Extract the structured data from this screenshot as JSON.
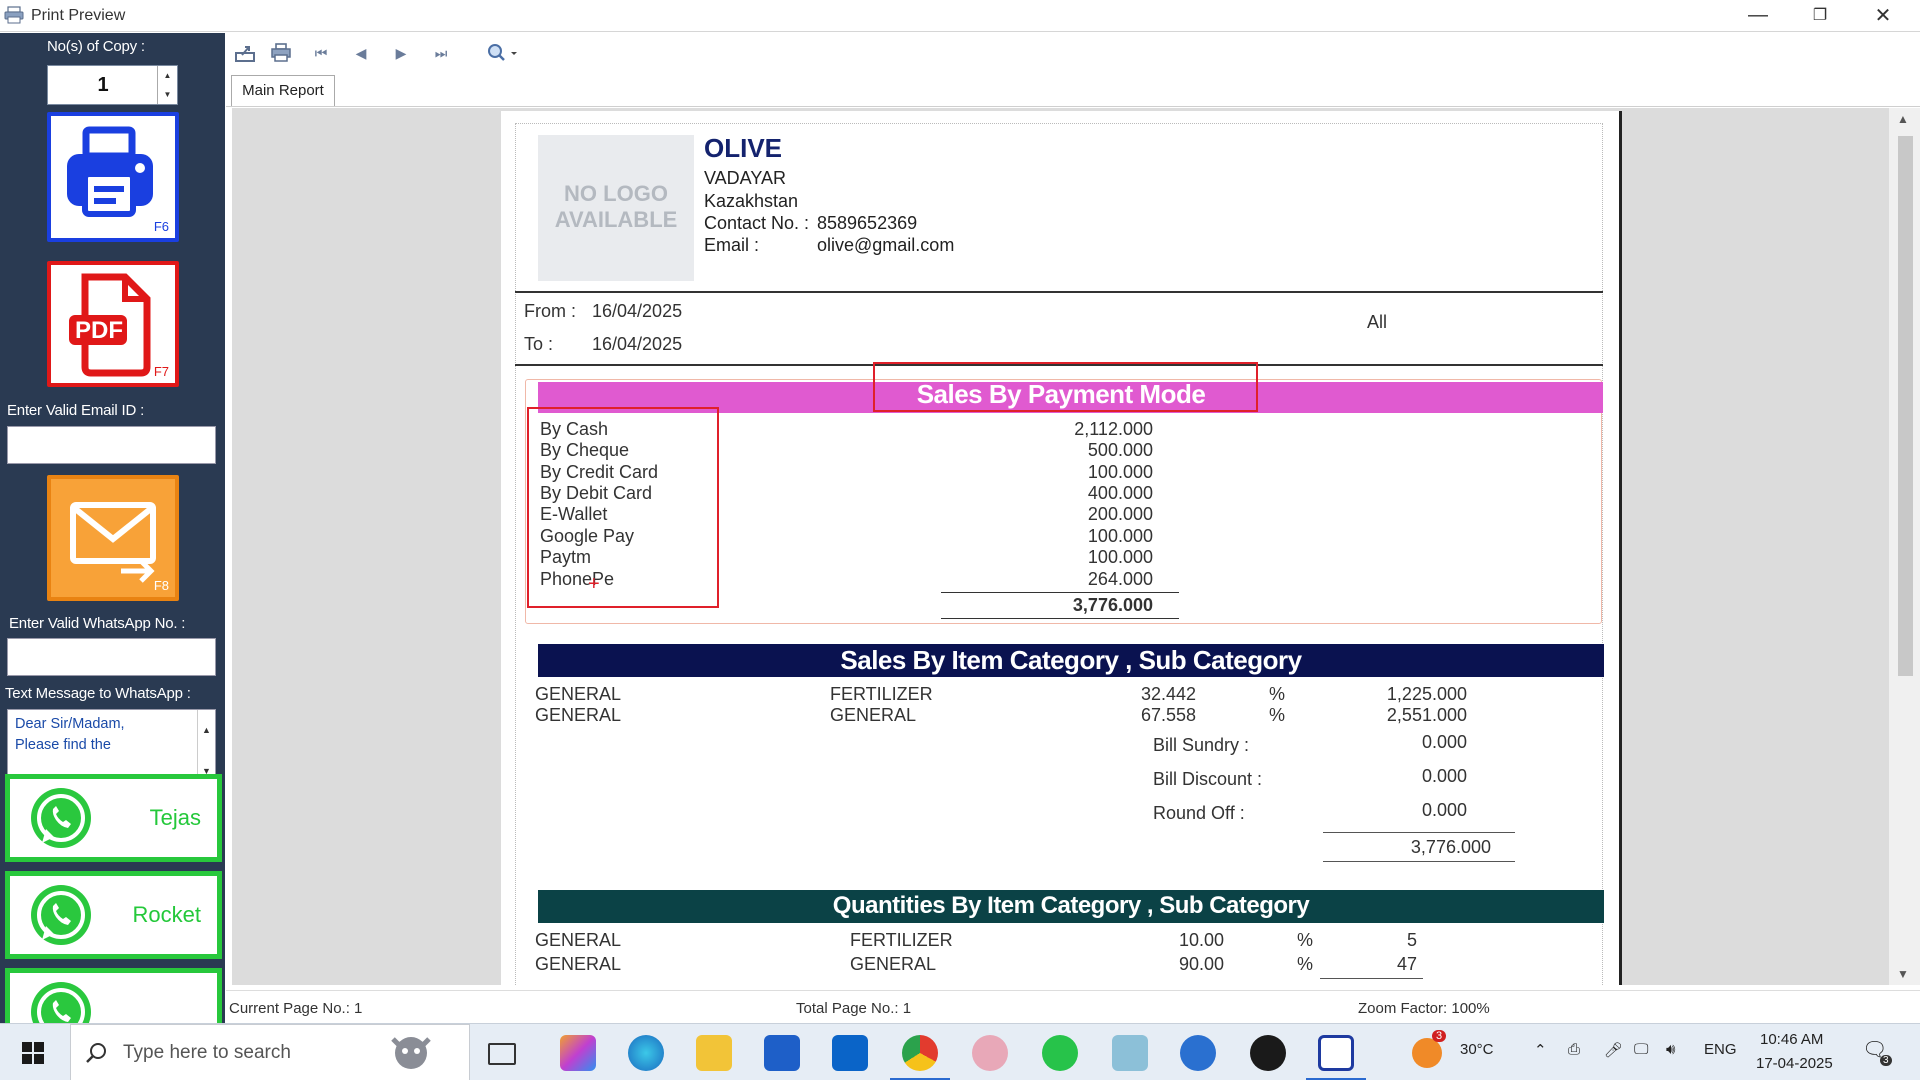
{
  "window": {
    "title": "Print Preview",
    "minimize_glyph": "—",
    "restore_glyph": "❐",
    "close_glyph": "✕"
  },
  "left_panel": {
    "copies_label": "No(s) of Copy :",
    "copies_value": "1",
    "print_shortcut": "F6",
    "pdf_label": "PDF",
    "pdf_shortcut": "F7",
    "email_label": "Enter Valid Email ID :",
    "email_value": "",
    "email_shortcut": "F8",
    "whatsapp_label": "Enter Valid WhatsApp No. :",
    "whatsapp_value": "",
    "message_label": "Text Message to WhatsApp :",
    "message_value": "Dear Sir/Madam,\nPlease find the",
    "contacts": [
      {
        "name": "Tejas"
      },
      {
        "name": "Rocket"
      },
      {
        "name": ""
      }
    ]
  },
  "toolbar": {
    "tab_label": "Main Report"
  },
  "report": {
    "logo_text": "NO LOGO\nAVAILABLE",
    "company_name": "OLIVE",
    "address_1": "VADAYAR",
    "address_2": "Kazakhstan",
    "contact_label": "Contact No. :",
    "contact_value": "8589652369",
    "email_label": "Email :",
    "email_value": "olive@gmail.com",
    "from_label": "From :",
    "from_value": "16/04/2025",
    "to_label": "To :",
    "to_value": "16/04/2025",
    "filter_value": "All",
    "payment_title": "Sales By Payment Mode",
    "payments": [
      {
        "mode": "By Cash",
        "amount": "2,112.000"
      },
      {
        "mode": "By Cheque",
        "amount": "500.000"
      },
      {
        "mode": "By Credit Card",
        "amount": "100.000"
      },
      {
        "mode": "By Debit Card",
        "amount": "400.000"
      },
      {
        "mode": "E-Wallet",
        "amount": "200.000"
      },
      {
        "mode": "Google Pay",
        "amount": "100.000"
      },
      {
        "mode": "Paytm",
        "amount": "100.000"
      },
      {
        "mode": "PhonePe",
        "amount": "264.000"
      }
    ],
    "payment_total": "3,776.000",
    "category_title": "Sales By Item Category , Sub Category",
    "categories": [
      {
        "category": "GENERAL",
        "sub": "FERTILIZER",
        "pct": "32.442",
        "pct_sign": "%",
        "amount": "1,225.000"
      },
      {
        "category": "GENERAL",
        "sub": "GENERAL",
        "pct": "67.558",
        "pct_sign": "%",
        "amount": "2,551.000"
      }
    ],
    "bill_sundry_label": "Bill Sundry :",
    "bill_sundry_value": "0.000",
    "bill_discount_label": "Bill Discount :",
    "bill_discount_value": "0.000",
    "round_off_label": "Round Off :",
    "round_off_value": "0.000",
    "category_total": "3,776.000",
    "qty_title": "Quantities By Item Category , Sub Category",
    "quantities": [
      {
        "category": "GENERAL",
        "sub": "FERTILIZER",
        "pct": "10.00",
        "pct_sign": "%",
        "qty": "5"
      },
      {
        "category": "GENERAL",
        "sub": "GENERAL",
        "pct": "90.00",
        "pct_sign": "%",
        "qty": "47"
      }
    ]
  },
  "status": {
    "current_page": "Current Page No.: 1",
    "total_page": "Total Page No.: 1",
    "zoom": "Zoom Factor: 100%"
  },
  "taskbar": {
    "search_placeholder": "Type here to search",
    "weather_temp": "30°C",
    "weather_badge": "3",
    "language": "ENG",
    "time": "10:46 AM",
    "date": "17-04-2025",
    "notification_count": "3"
  },
  "colors": {
    "left_panel_bg": "#2a3a52",
    "payment_header": "#e05ad0",
    "category_header": "#0a1250",
    "qty_header": "#0b4246",
    "company_name": "#14236e",
    "whatsapp_green": "#28c83c",
    "highlight_red": "#e0202a"
  }
}
